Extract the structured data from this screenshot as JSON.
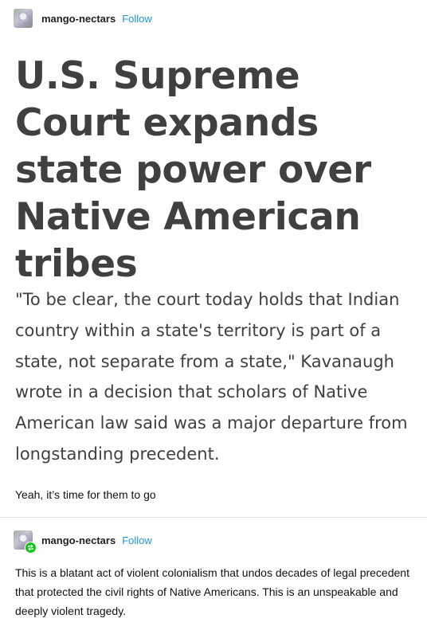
{
  "post": {
    "username": "mango-nectars",
    "follow_label": "Follow",
    "headline": "U.S. Supreme Court expands state power over Native American tribes",
    "quote": "\"To be clear, the court today holds that Indian country within a state's territory is part of a state, not separate from a state,\" Kavanaugh wrote in a decision that scholars of Native American law said was a major departure from longstanding precedent.",
    "caption": "Yeah, it’s time for them to go"
  },
  "reblog": {
    "username": "mango-nectars",
    "follow_label": "Follow",
    "body": "This is a blatant act of violent colonialism that undos decades of legal precedent that protected the civil rights of Native Americans. This is an unspeakable and deeply violent tragedy."
  },
  "icons": {
    "reblog_badge": "reblog-icon"
  },
  "colors": {
    "follow": "#1a9bd7",
    "reblog_badge": "#15c21a",
    "headline_text": "#404040"
  }
}
